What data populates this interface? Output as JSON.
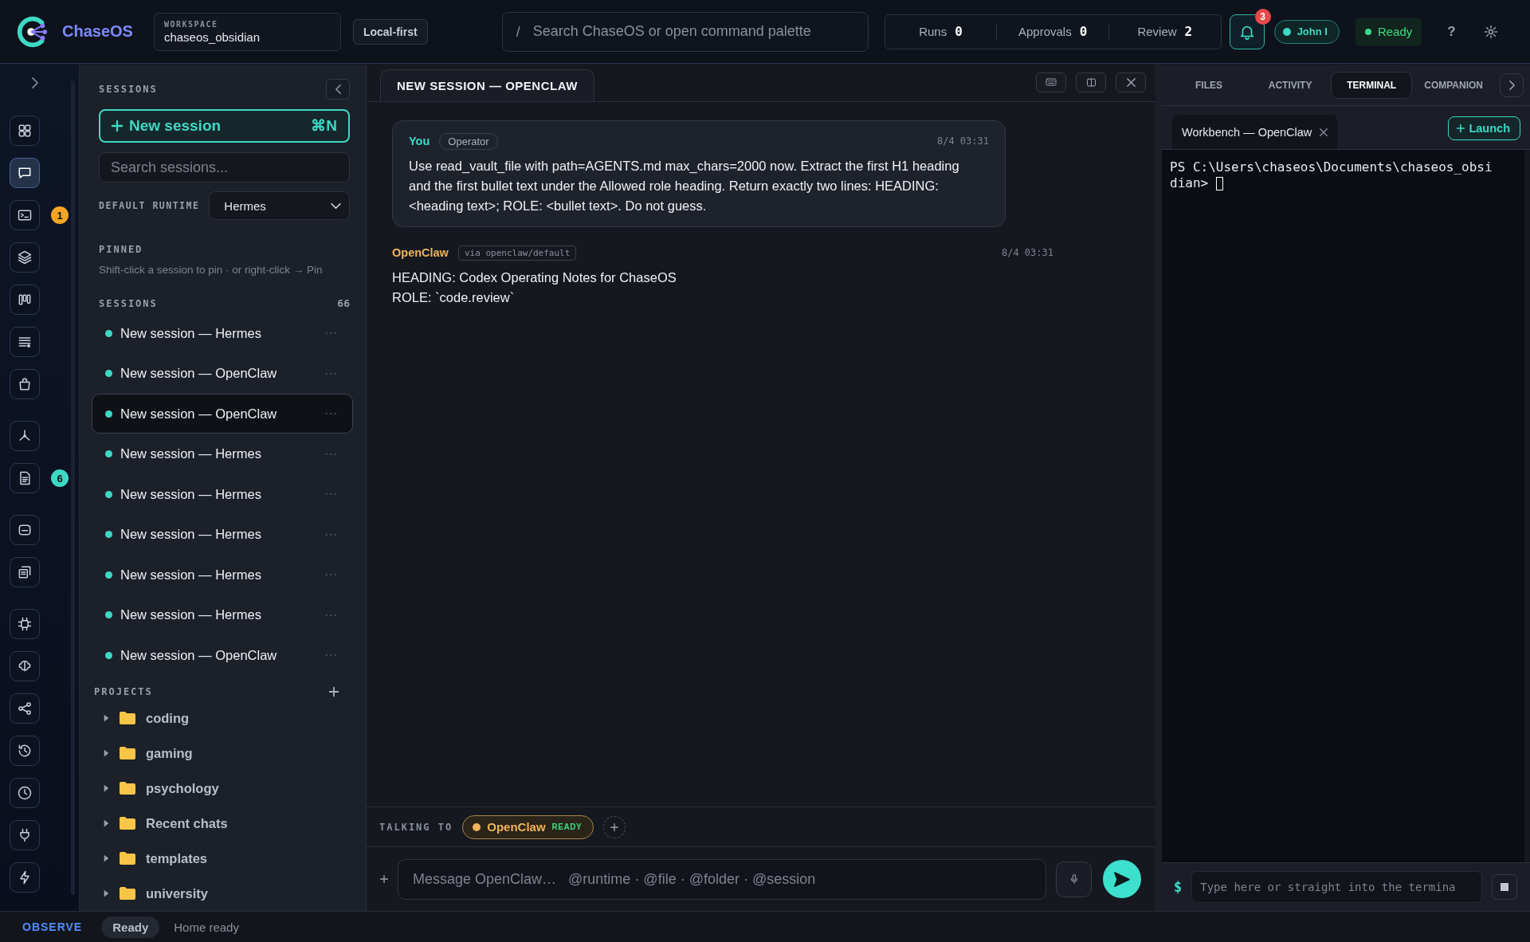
{
  "app": {
    "name": "ChaseOS"
  },
  "workspace": {
    "label": "WORKSPACE",
    "name": "chaseos_obsidian"
  },
  "mode_badge": "Local-first",
  "search": {
    "prefix": "/",
    "placeholder": "Search ChaseOS or open command palette"
  },
  "stats": [
    {
      "label": "Runs",
      "value": "0"
    },
    {
      "label": "Approvals",
      "value": "0"
    },
    {
      "label": "Review",
      "value": "2"
    }
  ],
  "notifications": {
    "count": "3"
  },
  "user": {
    "name": "John I"
  },
  "status": {
    "label": "Ready"
  },
  "help": "?",
  "rail": {
    "groups": [
      [
        {
          "selected": false
        },
        {
          "selected": true
        },
        {
          "selected": false,
          "badge": {
            "text": "1",
            "color": "#f5a524"
          }
        },
        {
          "selected": false
        },
        {
          "selected": false
        },
        {
          "selected": false
        },
        {
          "selected": false
        }
      ],
      [
        {
          "selected": false
        },
        {
          "selected": false,
          "badge": {
            "text": "6",
            "color": "#3dd9c5"
          }
        }
      ],
      [
        {
          "selected": false
        },
        {
          "selected": false
        }
      ],
      [
        {
          "selected": false
        },
        {
          "selected": false
        },
        {
          "selected": false
        },
        {
          "selected": false
        },
        {
          "selected": false
        },
        {
          "selected": false
        },
        {
          "selected": false
        }
      ]
    ]
  },
  "sidebar": {
    "title": "SESSIONS",
    "new_button": "New session",
    "shortcut": "⌘N",
    "search_placeholder": "Search sessions...",
    "runtime_label": "DEFAULT RUNTIME",
    "runtime_value": "Hermes",
    "pinned_title": "PINNED",
    "pinned_hint": "Shift-click a session to pin · or right-click → Pin",
    "sessions_title": "SESSIONS",
    "sessions_count": "66",
    "sessions": [
      {
        "title": "New session — Hermes",
        "selected": false
      },
      {
        "title": "New session — OpenClaw",
        "selected": false
      },
      {
        "title": "New session — OpenClaw",
        "selected": true
      },
      {
        "title": "New session — Hermes",
        "selected": false
      },
      {
        "title": "New session — Hermes",
        "selected": false
      },
      {
        "title": "New session — Hermes",
        "selected": false
      },
      {
        "title": "New session — Hermes",
        "selected": false
      },
      {
        "title": "New session — Hermes",
        "selected": false
      },
      {
        "title": "New session — OpenClaw",
        "selected": false
      }
    ],
    "projects_title": "PROJECTS",
    "projects": [
      {
        "name": "coding",
        "expanded": false
      },
      {
        "name": "gaming",
        "expanded": false
      },
      {
        "name": "psychology",
        "expanded": false
      },
      {
        "name": "Recent chats",
        "expanded": false
      },
      {
        "name": "templates",
        "expanded": false
      },
      {
        "name": "university",
        "expanded": false
      }
    ]
  },
  "chat": {
    "tab_title": "NEW SESSION — OPENCLAW",
    "messages": [
      {
        "kind": "user",
        "author": "You",
        "tag": "Operator",
        "time": "8/4 03:31",
        "lines": [
          "Use read_vault_file with path=AGENTS.md max_chars=2000 now. Extract the first H1 heading and the first bullet text under the Allowed role heading. Return exactly two lines: HEADING: <heading text>; ROLE: <bullet text>. Do not guess."
        ]
      },
      {
        "kind": "agent",
        "author": "OpenClaw",
        "tag": "via openclaw/default",
        "time": "8/4 03:31",
        "lines": [
          "HEADING: Codex Operating Notes for ChaseOS",
          "ROLE: `code.review`"
        ]
      }
    ],
    "talking_to_label": "TALKING TO",
    "agent": {
      "name": "OpenClaw",
      "state": "READY"
    },
    "composer": {
      "placeholder": "Message OpenClaw…   @runtime · @file · @folder · @session"
    }
  },
  "right_panel": {
    "tabs": [
      {
        "label": "FILES",
        "selected": false
      },
      {
        "label": "ACTIVITY",
        "selected": false
      },
      {
        "label": "TERMINAL",
        "selected": true
      },
      {
        "label": "COMPANION",
        "selected": false
      }
    ],
    "terminal_tab": "Workbench — OpenClaw",
    "launch_button": "Launch",
    "terminal_lines": [
      "PS C:\\Users\\chaseos\\Documents\\chaseos_obsi",
      "dian>"
    ],
    "prompt": "$",
    "input_placeholder": "Type here or straight into the termina"
  },
  "status_bar": {
    "mode": "OBSERVE",
    "state": "Ready",
    "message": "Home ready"
  }
}
